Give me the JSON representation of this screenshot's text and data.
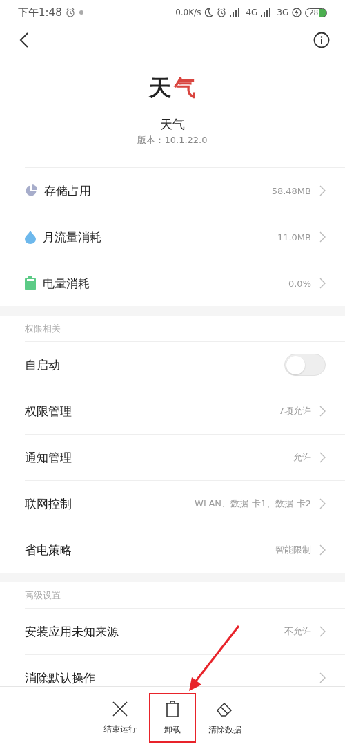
{
  "status_bar": {
    "time": "下午1:48",
    "speed": "0.0K/s",
    "network_1": "4G",
    "network_2": "3G",
    "battery": "28"
  },
  "app": {
    "logo": [
      {
        "text": "天",
        "color": "#222222"
      },
      {
        "text": "气",
        "color": "#d9453f"
      }
    ],
    "name": "天气",
    "version": "版本：10.1.22.0"
  },
  "usage": [
    {
      "label": "存储占用",
      "value": "58.48MB"
    },
    {
      "label": "月流量消耗",
      "value": "11.0MB"
    },
    {
      "label": "电量消耗",
      "value": "0.0%"
    }
  ],
  "sections": [
    {
      "title": "权限相关",
      "items": [
        {
          "kind": "toggle",
          "label": "自启动",
          "on": false
        },
        {
          "kind": "nav",
          "label": "权限管理",
          "value": "7项允许"
        },
        {
          "kind": "nav",
          "label": "通知管理",
          "value": "允许"
        },
        {
          "kind": "nav",
          "label": "联网控制",
          "value": "WLAN、数据-卡1、数据-卡2"
        },
        {
          "kind": "nav",
          "label": "省电策略",
          "value": "智能限制"
        }
      ]
    },
    {
      "title": "高级设置",
      "items": [
        {
          "kind": "nav",
          "label": "安装应用未知来源",
          "value": "不允许"
        },
        {
          "kind": "nav",
          "label": "消除默认操作"
        }
      ]
    }
  ],
  "actions": [
    {
      "label": "结束运行",
      "highlighted": false
    },
    {
      "label": "卸载",
      "highlighted": true
    },
    {
      "label": "清除数据",
      "highlighted": false
    }
  ]
}
